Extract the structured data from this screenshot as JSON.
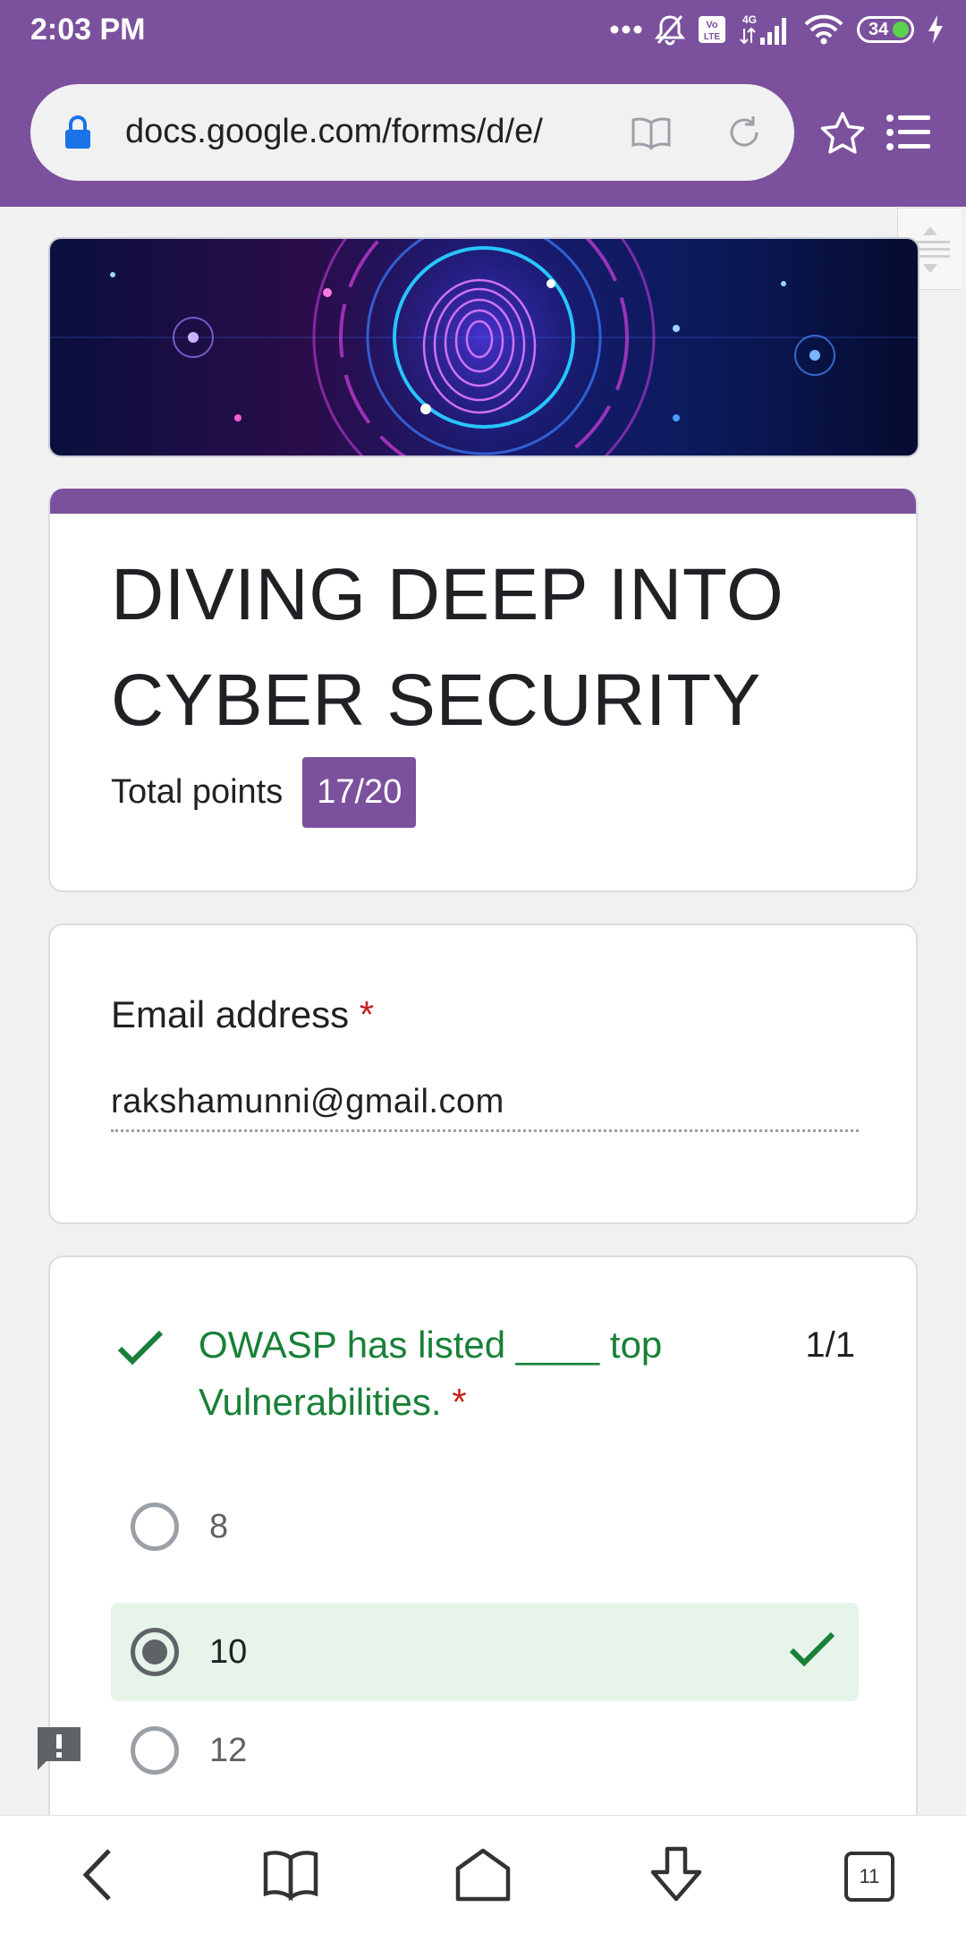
{
  "status_bar": {
    "time": "2:03 PM",
    "battery_level": "34",
    "icons": [
      "more-dots-icon",
      "bell-off-icon",
      "volte-icon",
      "signal-4g-icon",
      "wifi-icon",
      "battery-icon",
      "charging-icon"
    ]
  },
  "browser": {
    "url": "docs.google.com/forms/d/e/",
    "icons": [
      "lock-icon",
      "reader-mode-icon",
      "reload-icon",
      "star-icon",
      "menu-icon"
    ]
  },
  "form": {
    "title": "DIVING DEEP INTO CYBER SECURITY",
    "points_label": "Total points",
    "points_value": "17/20",
    "accent_color": "#7b519d"
  },
  "email": {
    "label": "Email address",
    "required_mark": "*",
    "value": "rakshamunni@gmail.com"
  },
  "question": {
    "text": "OWASP has listed ____ top Vulnerabilities.",
    "required_mark": "*",
    "score": "1/1",
    "correct_color": "#188038",
    "options": [
      {
        "label": "8",
        "selected": false
      },
      {
        "label": "10",
        "selected": true,
        "correct": true
      },
      {
        "label": "12",
        "selected": false
      }
    ]
  },
  "bottom_nav": {
    "tab_count": "11",
    "icons": [
      "back-icon",
      "bookmarks-icon",
      "home-icon",
      "download-icon",
      "tabs-icon"
    ]
  }
}
